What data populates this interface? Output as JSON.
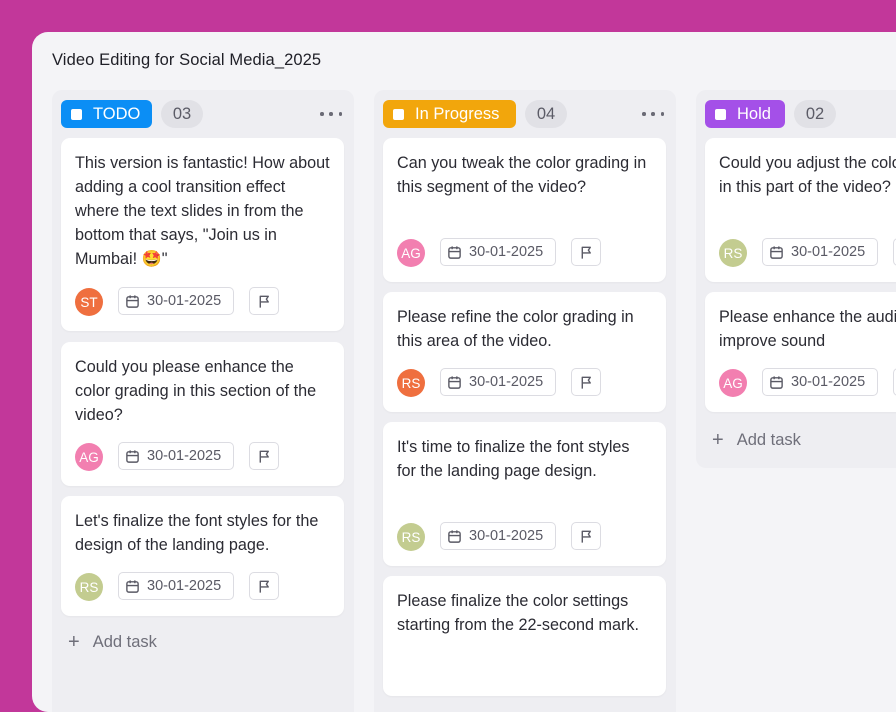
{
  "board": {
    "title": "Video Editing for Social Media_2025"
  },
  "colors": {
    "background": "#c2379a",
    "todo": "#0b8ef5",
    "in_progress": "#f2a60c",
    "hold": "#a450e8",
    "avatar_st": "#ef6f3f",
    "avatar_ag": "#f27fb0",
    "avatar_rs_orange": "#ef6f3f",
    "avatar_rs_green": "#c3cc90"
  },
  "columns": [
    {
      "status": "TODO",
      "count": "03",
      "more_icon": "more-horizontal-icon",
      "add_task": "Add task",
      "cards": [
        {
          "text": "This version is fantastic! How about adding a cool transition effect where the text slides in from the bottom that says, \"Join us in Mumbai! 🤩\"",
          "avatar": "ST",
          "date": "30-01-2025"
        },
        {
          "text": "Could you please enhance the color grading in this section of the video?",
          "avatar": "AG",
          "date": "30-01-2025"
        },
        {
          "text": "Let's finalize the font styles for the design of the landing page.",
          "avatar": "RS",
          "date": "30-01-2025"
        }
      ]
    },
    {
      "status": "In Progress",
      "count": "04",
      "more_icon": "more-horizontal-icon",
      "cards": [
        {
          "text": "Can you tweak the color grading in this segment of the video?",
          "avatar": "AG",
          "date": "30-01-2025"
        },
        {
          "text": "Please refine the color grading in this area of the video.",
          "avatar": "RS",
          "date": "30-01-2025"
        },
        {
          "text": "It's time to finalize the font styles for the landing page design.",
          "avatar": "RS",
          "date": "30-01-2025"
        },
        {
          "text": "Please finalize the color settings starting from the 22-second mark."
        }
      ]
    },
    {
      "status": "Hold",
      "count": "02",
      "add_task": "Add task",
      "cards": [
        {
          "text": "Could you adjust the color grading in this part of the video?",
          "avatar": "RS",
          "date": "30-01-2025"
        },
        {
          "text": "Please enhance the audio levels to improve sound",
          "avatar": "AG",
          "date": "30-01-2025"
        }
      ]
    }
  ]
}
